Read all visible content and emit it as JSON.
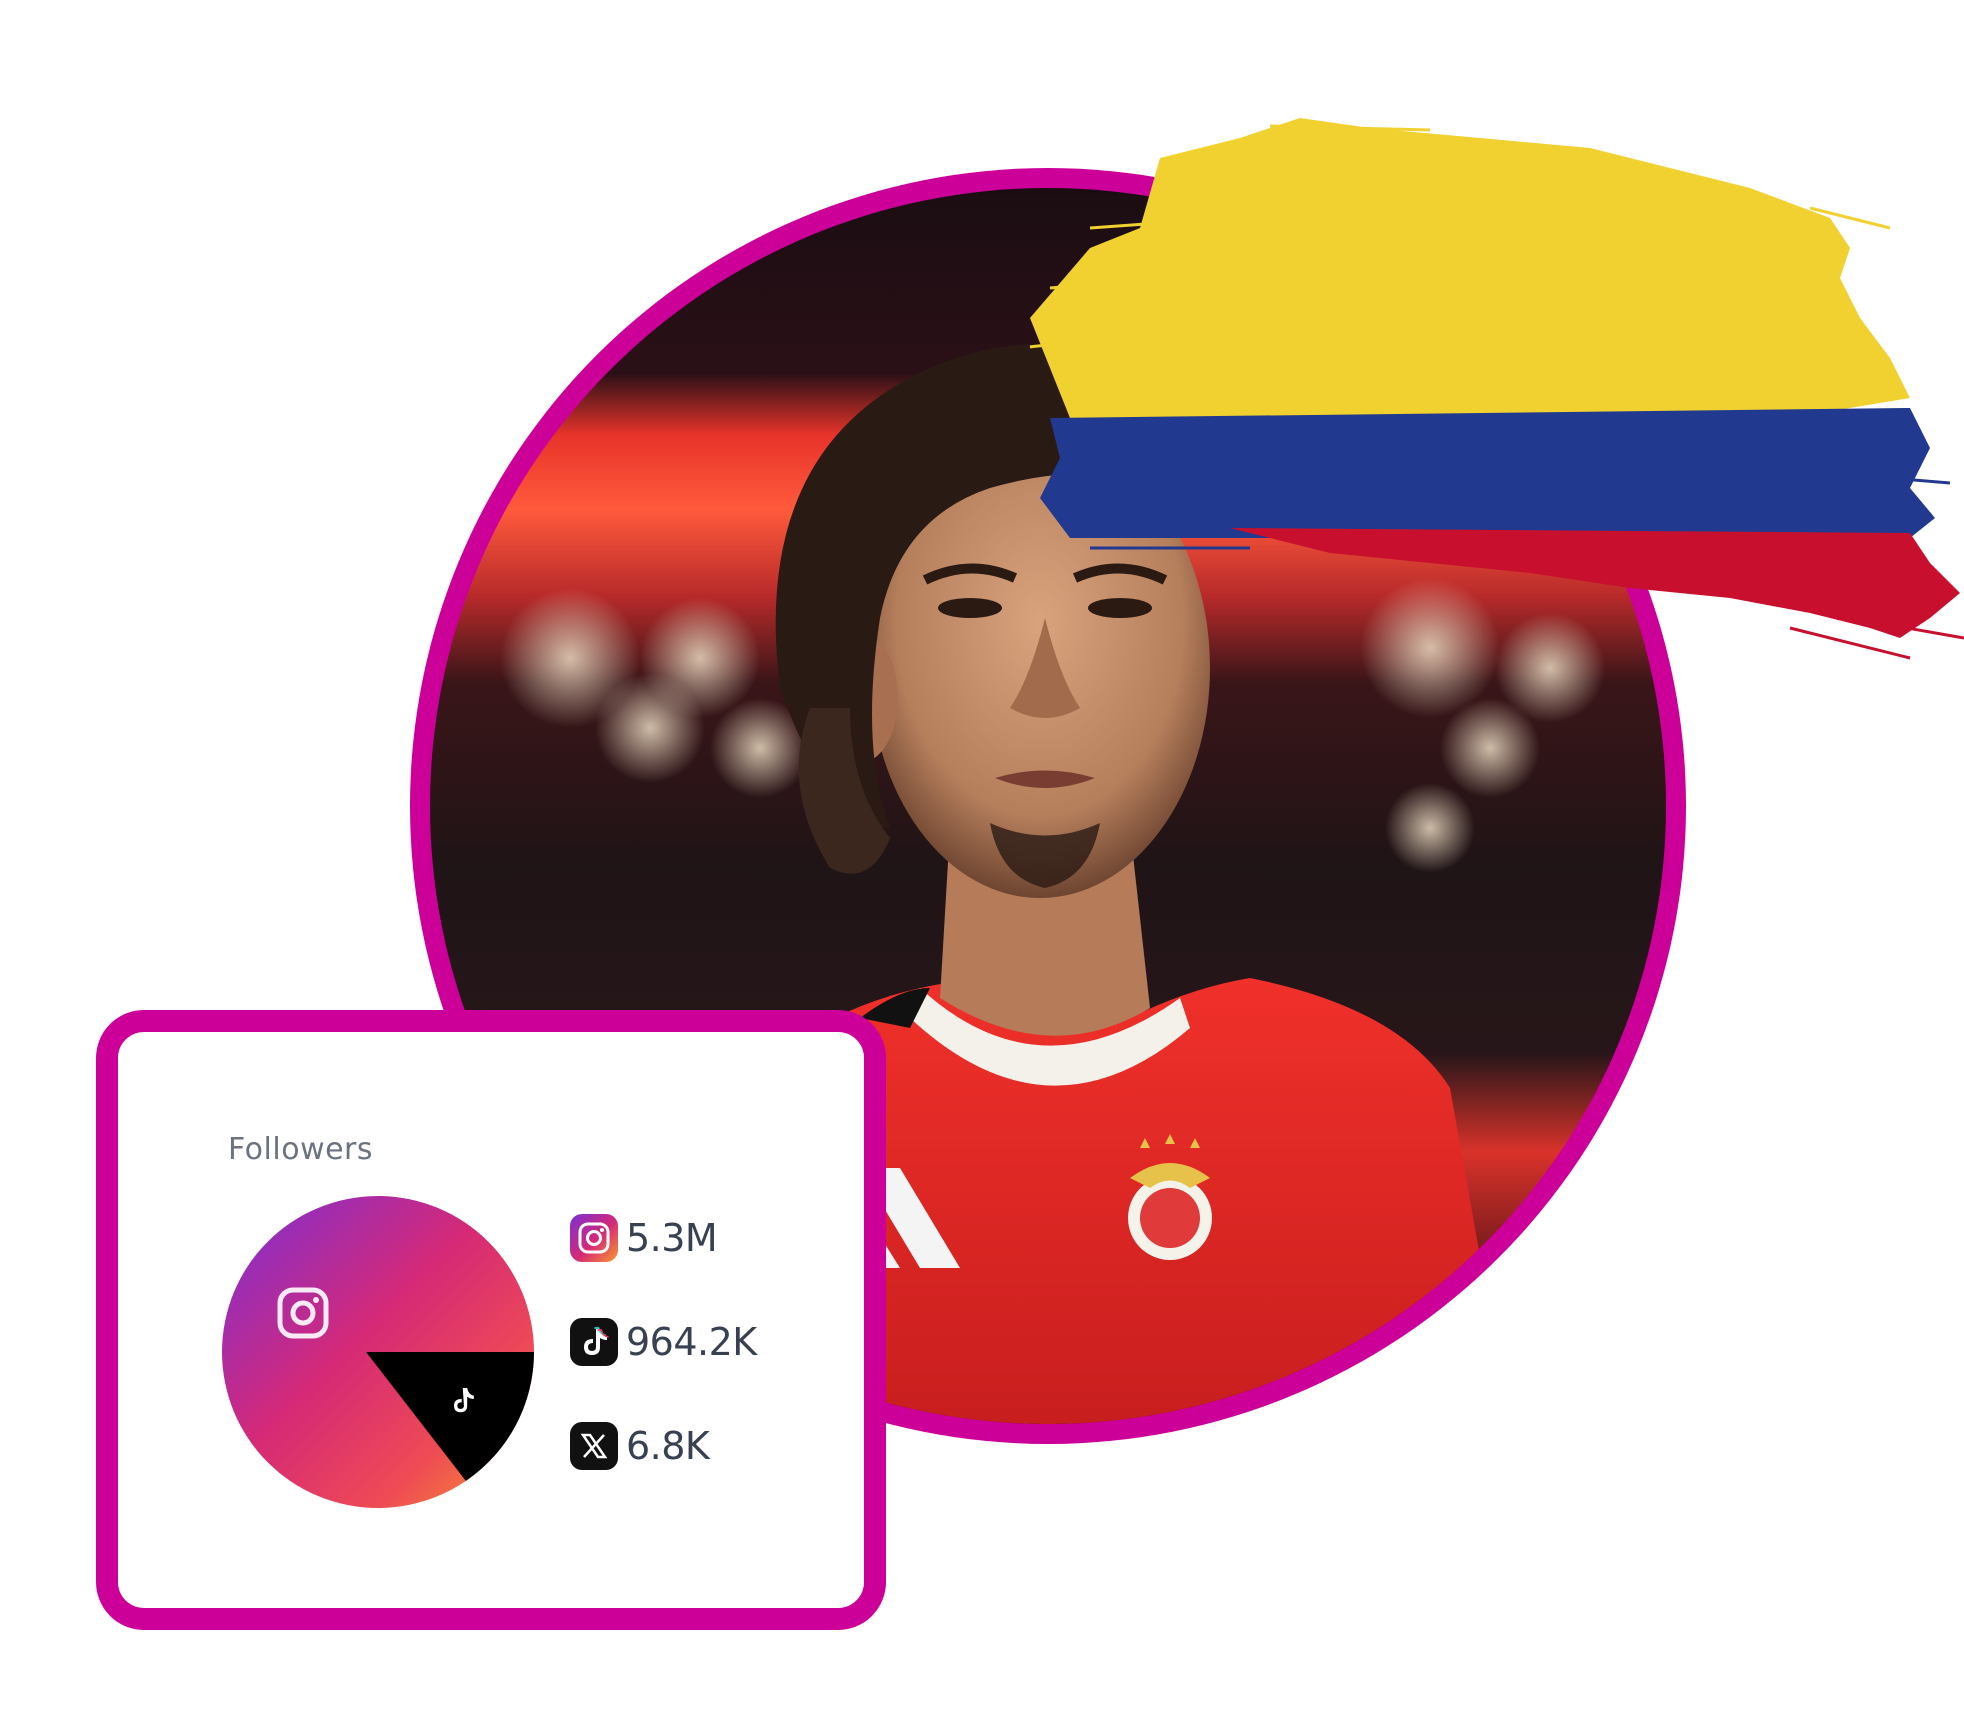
{
  "profile": {
    "photo_description_icon": "player-photo",
    "ring_color": "#cc0099"
  },
  "flag": {
    "icon": "colombia-flag-brush-icon",
    "colors": [
      "#f0d130",
      "#213a8f",
      "#c8102e"
    ]
  },
  "followers_card": {
    "title": "Followers",
    "accent_color": "#cc0099",
    "stats": [
      {
        "platform_icon": "instagram-icon",
        "value": "5.3M"
      },
      {
        "platform_icon": "tiktok-icon",
        "value": "964.2K"
      },
      {
        "platform_icon": "x-icon",
        "value": "6.8K"
      }
    ]
  },
  "chart_data": {
    "type": "pie",
    "title": "",
    "slices": [
      {
        "label": "instagram",
        "value": 5300000,
        "color": "instagram-gradient"
      },
      {
        "label": "tiktok",
        "value": 964200,
        "color": "#000000"
      },
      {
        "label": "x",
        "value": 6800,
        "color": "#000000"
      }
    ]
  }
}
